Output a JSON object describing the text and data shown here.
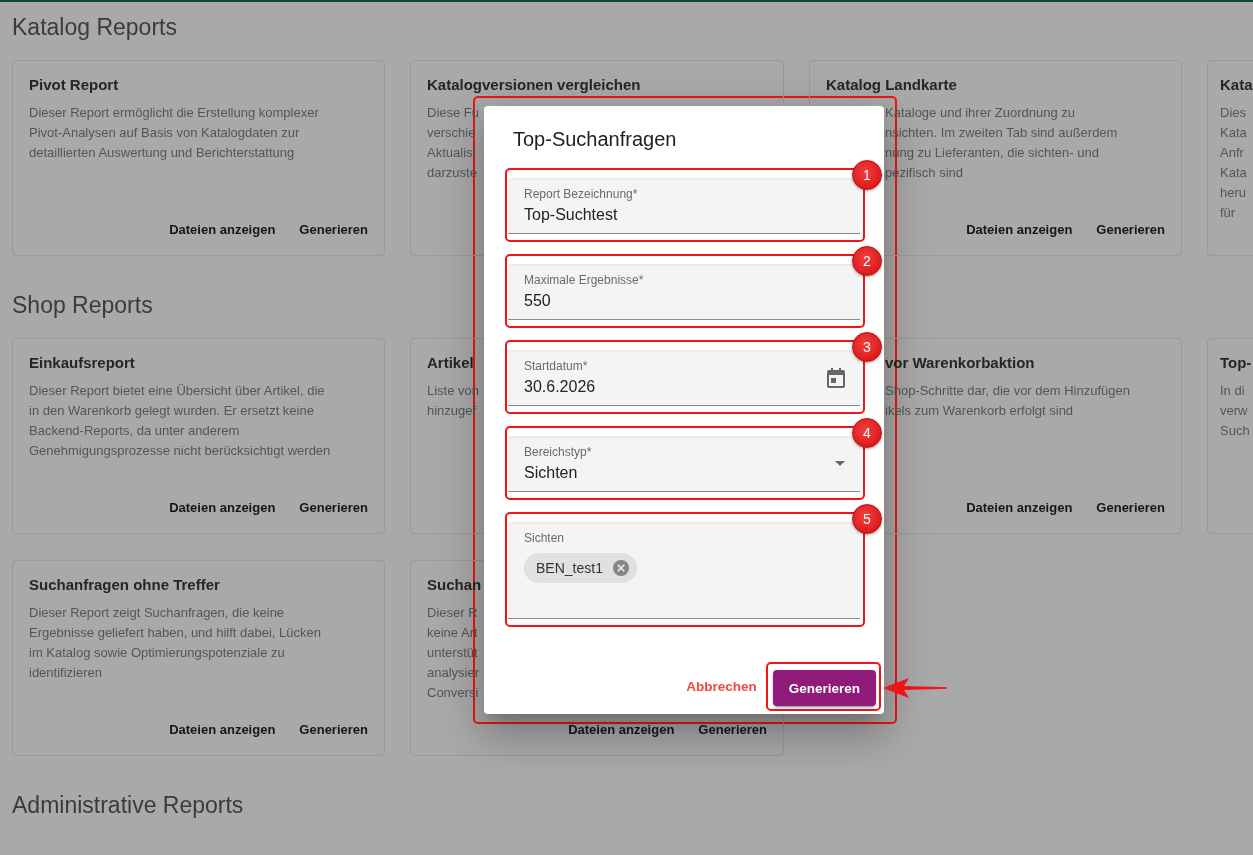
{
  "sections": [
    {
      "title": "Katalog Reports",
      "cards": [
        {
          "title": "Pivot Report",
          "description": "Dieser Report ermöglicht die Erstellung komplexer\nPivot-Analysen auf Basis von Katalogdaten zur\ndetaillierten Auswertung und Berichterstattung",
          "actions": [
            "Dateien anzeigen",
            "Generieren"
          ]
        },
        {
          "title": "Katalogversionen vergleichen",
          "description": "Diese Fu\nverschie\nAktualisi\ndarzuste"
        },
        {
          "title": "Katalog Landkarte",
          "description_tail": "Kataloge und ihrer Zuordnung zu\nnsichten. Im zweiten Tab sind außerdem\nnung zu Lieferanten, die sichten- und\npezifisch sind",
          "actions": [
            "Dateien anzeigen",
            "Generieren"
          ]
        },
        {
          "title": "Kata",
          "description": "Dies\nKata\nAnfr\nKata\nheru\nfür"
        }
      ]
    },
    {
      "title": "Shop Reports",
      "cards": [
        {
          "title": "Einkaufsreport",
          "description": "Dieser Report bietet eine Übersicht über Artikel, die\nin den Warenkorb gelegt wurden. Er ersetzt keine\nBackend-Reports, da unter anderem\nGenehmigungsprozesse nicht berücksichtigt werden",
          "actions": [
            "Dateien anzeigen",
            "Generieren"
          ]
        },
        {
          "title": "Artikel",
          "description": "Liste von\nhinzugef"
        },
        {
          "title_tail": "vor Warenkorbaktion",
          "description_tail": "Shop-Schritte dar, die vor dem Hinzufügen\nikels zum Warenkorb erfolgt sind",
          "actions": [
            "Dateien anzeigen",
            "Generieren"
          ]
        },
        {
          "title": "Top-",
          "description": "In di\nverw\nSuch"
        },
        {
          "title": "Suchanfragen ohne Treffer",
          "description": "Dieser Report zeigt Suchanfragen, die keine\nErgebnisse geliefert haben, und hilft dabei, Lücken\nim Katalog sowie Optimierungspotenziale zu\nidentifizieren",
          "actions": [
            "Dateien anzeigen",
            "Generieren"
          ]
        },
        {
          "title": "Suchan",
          "description": "Dieser R\nkeine Art\nunterstüt\nanalysier\nConversi",
          "actions": [
            "Dateien anzeigen",
            "Generieren"
          ]
        }
      ]
    },
    {
      "title": "Administrative Reports"
    }
  ],
  "dialog": {
    "highlighted": true,
    "title": "Top-Suchanfragen",
    "fields": [
      {
        "kind": "text",
        "label": "Report Bezeichnung*",
        "value": "Top-Suchtest",
        "marker": "1"
      },
      {
        "kind": "text",
        "label": "Maximale Ergebnisse*",
        "value": "550",
        "marker": "2"
      },
      {
        "kind": "date",
        "label": "Startdatum*",
        "value": "30.6.2026",
        "marker": "3"
      },
      {
        "kind": "select",
        "label": "Bereichstyp*",
        "value": "Sichten",
        "marker": "4"
      },
      {
        "kind": "chips",
        "label": "Sichten",
        "chips": [
          "BEN_test1"
        ],
        "marker": "5"
      }
    ],
    "cancel": "Abbrechen",
    "submit": {
      "label": "Generieren",
      "highlighted": true
    }
  }
}
